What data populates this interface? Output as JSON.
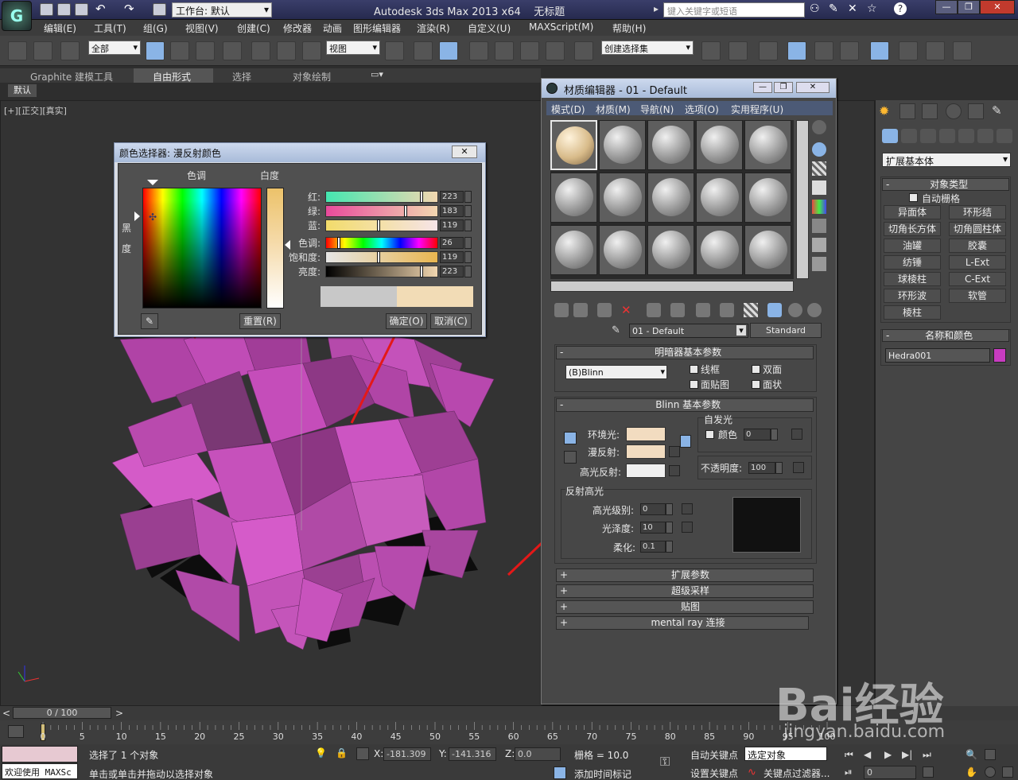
{
  "titlebar": {
    "workspace_label": "工作台: 默认",
    "app_title": "Autodesk 3ds Max  2013 x64",
    "file_title": "无标题",
    "search_placeholder": "键入关键字或短语"
  },
  "menubar": [
    "编辑(E)",
    "工具(T)",
    "组(G)",
    "视图(V)",
    "创建(C)",
    "修改器",
    "动画",
    "图形编辑器",
    "渲染(R)",
    "自定义(U)",
    "MAXScript(M)",
    "帮助(H)"
  ],
  "toolbar": {
    "selection_filter": "全部",
    "ref_coord": "视图",
    "named_selection": "创建选择集"
  },
  "ribbon": {
    "tabs": [
      "Graphite 建模工具",
      "自由形式",
      "选择",
      "对象绘制"
    ],
    "active_tab": "自由形式",
    "default_tab": "默认"
  },
  "viewport": {
    "label": "[+][正交][真实]"
  },
  "color_picker": {
    "title": "颜色选择器: 漫反射颜色",
    "hue_label": "色调",
    "whiteness_label": "白度",
    "black_label": "黑",
    "degree_label": "度",
    "channels": [
      {
        "label": "红:",
        "value": "223",
        "fraction": 0.87,
        "gradient": "#44e6b0,#f2d7b0"
      },
      {
        "label": "绿:",
        "value": "183",
        "fraction": 0.72,
        "gradient": "#e84a9c,#f2d7b0"
      },
      {
        "label": "蓝:",
        "value": "119",
        "fraction": 0.47,
        "gradient": "#f2dc6a,#f6e4e8"
      },
      {
        "label": "色调:",
        "value": "26",
        "fraction": 0.1,
        "gradient": "#ff0000,#ffff00,#00ff00,#00ffff,#0000ff,#ff00ff,#ff0000"
      },
      {
        "label": "饱和度:",
        "value": "119",
        "fraction": 0.47,
        "gradient": "#e6e6e6,#e8b650"
      },
      {
        "label": "亮度:",
        "value": "223",
        "fraction": 0.87,
        "gradient": "#000000,#f2d7b0"
      }
    ],
    "old_color": "#c8c8c8",
    "new_color": "#f2dcb6",
    "reset_label": "重置(R)",
    "ok_label": "确定(O)",
    "cancel_label": "取消(C)"
  },
  "material_editor": {
    "title": "材质编辑器 - 01 - Default",
    "menu": [
      "模式(D)",
      "材质(M)",
      "导航(N)",
      "选项(O)",
      "实用程序(U)"
    ],
    "material_name": "01 - Default",
    "material_type": "Standard",
    "shader_rollout": "明暗器基本参数",
    "shader": "(B)Blinn",
    "shader_checks": [
      "线框",
      "双面",
      "面贴图",
      "面状"
    ],
    "blinn_rollout": "Blinn 基本参数",
    "self_illum_label": "自发光",
    "color_label": "颜色",
    "self_illum_value": "0",
    "ambient_label": "环境光:",
    "diffuse_label": "漫反射:",
    "specular_label": "高光反射:",
    "ambient_color": "#f2dcc0",
    "diffuse_color": "#f2dcc0",
    "specular_color": "#f0f0f0",
    "opacity_label": "不透明度:",
    "opacity_value": "100",
    "specular_section": "反射高光",
    "spec_level_label": "高光级别:",
    "spec_level": "0",
    "gloss_label": "光泽度:",
    "gloss": "10",
    "soften_label": "柔化:",
    "soften": "0.1",
    "collapsed_rollouts": [
      "扩展参数",
      "超级采样",
      "贴图",
      "mental ray 连接"
    ]
  },
  "command_panel": {
    "dropdown": "扩展基本体",
    "object_type_title": "对象类型",
    "autogrid_label": "自动栅格",
    "buttons": [
      "异面体",
      "环形结",
      "切角长方体",
      "切角圆柱体",
      "油罐",
      "胶囊",
      "纺锤",
      "L-Ext",
      "球棱柱",
      "C-Ext",
      "环形波",
      "软管",
      "棱柱"
    ],
    "name_color_title": "名称和颜色",
    "object_name": "Hedra001",
    "object_color": "#c83cc0"
  },
  "timeline": {
    "frame_readout": "0 / 100",
    "ticks": [
      "0",
      "5",
      "10",
      "15",
      "20",
      "25",
      "30",
      "35",
      "40",
      "45",
      "50",
      "55",
      "60",
      "65",
      "70",
      "75",
      "80",
      "85",
      "90",
      "95",
      "100"
    ]
  },
  "statusbar": {
    "maxscript_label": "欢迎使用 MAXSc",
    "selection_status": "选择了 1 个对象",
    "prompt": "单击或单击并拖动以选择对象",
    "x_label": "X:",
    "x_value": "-181.309",
    "y_label": "Y:",
    "y_value": "-141.316",
    "z_label": "Z:",
    "z_value": "0.0",
    "grid_label": "栅格 = 10.0",
    "add_time_tag": "添加时间标记",
    "auto_key": "自动关键点",
    "set_key": "设置关键点",
    "key_target": "选定对象",
    "key_filters": "关键点过滤器...",
    "frame_field": "0"
  },
  "watermark": {
    "brand": "Bai经验",
    "url": "jingyan.baidu.com"
  }
}
